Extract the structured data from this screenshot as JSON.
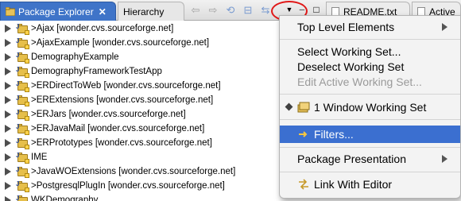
{
  "tabs": {
    "package_explorer": "Package Explorer",
    "close_glyph": "✕",
    "hierarchy": "Hierarchy"
  },
  "toolbar": {
    "back_icon": "⇦",
    "forward_icon": "⇨",
    "up_icon": "⟲",
    "collapse_icon": "⊟",
    "link_icon": "⇆",
    "view_menu_icon": "▼",
    "minimize_icon": "─",
    "maximize_icon": "□"
  },
  "editor_tabs": [
    {
      "label": "README.txt"
    },
    {
      "label": "Active"
    }
  ],
  "tree": {
    "items": [
      {
        "label": ">Ajax  [wonder.cvs.sourceforge.net]"
      },
      {
        "label": ">AjaxExample  [wonder.cvs.sourceforge.net]"
      },
      {
        "label": "DemographyExample"
      },
      {
        "label": "DemographyFrameworkTestApp"
      },
      {
        "label": ">ERDirectToWeb  [wonder.cvs.sourceforge.net]"
      },
      {
        "label": ">ERExtensions  [wonder.cvs.sourceforge.net]"
      },
      {
        "label": ">ERJars  [wonder.cvs.sourceforge.net]"
      },
      {
        "label": ">ERJavaMail  [wonder.cvs.sourceforge.net]"
      },
      {
        "label": ">ERPrototypes  [wonder.cvs.sourceforge.net]"
      },
      {
        "label": "IME"
      },
      {
        "label": ">JavaWOExtensions  [wonder.cvs.sourceforge.net]"
      },
      {
        "label": ">PostgresqlPlugIn  [wonder.cvs.sourceforge.net]"
      },
      {
        "label": "WKDemography"
      }
    ]
  },
  "menu": {
    "top_level_elements": "Top Level Elements",
    "select_working_set": "Select Working Set...",
    "deselect_working_set": "Deselect Working Set",
    "edit_active_working_set": "Edit Active Working Set...",
    "window_working_set": "1 Window Working Set",
    "filters": "Filters...",
    "package_presentation": "Package Presentation",
    "link_with_editor": "Link With Editor"
  },
  "colors": {
    "active_tab": "#3f74c8",
    "menu_selection": "#3b6fd0",
    "highlight_circle": "#e01818"
  }
}
